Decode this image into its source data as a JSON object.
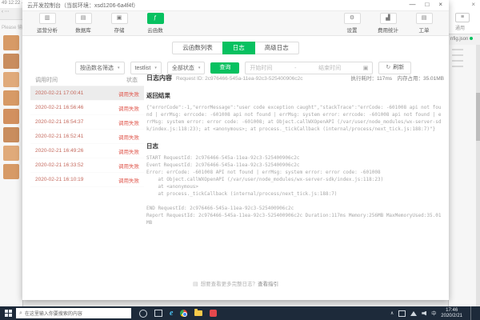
{
  "colors": {
    "accent": "#07c160",
    "error": "#e05a50",
    "date_text": "#c4685c"
  },
  "background_window": {
    "left_title": "49 12:22 -",
    "left_hint": "Please 输...",
    "right_close": "×",
    "right_menu_glyph": "≡",
    "right_label": "通用",
    "right_file_tab": "nfig.json"
  },
  "dialog": {
    "title": "云开发控制台（当前环境：xsd1206-6a4f4f）",
    "controls": {
      "minimize": "—",
      "maximize": "□",
      "close": "×"
    },
    "toolbar": {
      "nav": [
        {
          "label": "运营分析",
          "glyph": "▥"
        },
        {
          "label": "数据库",
          "glyph": "▤"
        },
        {
          "label": "存储",
          "glyph": "▣"
        },
        {
          "label": "云函数",
          "glyph": "ƒ"
        }
      ],
      "actions": [
        {
          "label": "设置",
          "glyph": "⚙"
        },
        {
          "label": "费用统计",
          "glyph": "▟"
        },
        {
          "label": "工单",
          "glyph": "▤"
        }
      ]
    },
    "tabs": [
      {
        "label": "云函数列表"
      },
      {
        "label": "日志"
      },
      {
        "label": "高级日志"
      }
    ],
    "filters": {
      "name_filter": "按函数名筛选",
      "function_name": "testlist",
      "status_filter": "全部状态",
      "query_label": "查询",
      "date_start_placeholder": "开始时间",
      "date_separator": "-",
      "date_end_placeholder": "结束时间",
      "calendar_glyph": "▣",
      "refresh_glyph": "↻",
      "refresh_label": "刷新",
      "caret": "▾"
    },
    "log_table": {
      "headers": [
        "调用时间",
        "状态"
      ],
      "rows": [
        {
          "time": "2020-02-21 17:00:41",
          "status": "调用失败"
        },
        {
          "time": "2020-02-21 16:56:46",
          "status": "调用失败"
        },
        {
          "time": "2020-02-21 16:54:37",
          "status": "调用失败"
        },
        {
          "time": "2020-02-21 16:52:41",
          "status": "调用失败"
        },
        {
          "time": "2020-02-21 16:49:26",
          "status": "调用失败"
        },
        {
          "time": "2020-02-21 16:33:52",
          "status": "调用失败"
        },
        {
          "time": "2020-02-21 16:10:19",
          "status": "调用失败"
        }
      ]
    },
    "detail": {
      "title": "日志内容",
      "request_id": "Request ID: 2c976466-545a-11ea-92c3-525400906c2c",
      "stats": "执行耗时：117ms　内存占用：35.01MB",
      "result_heading": "返回结果",
      "result_body": "{\"errorCode\":-1,\"errorMessage\":\"user code exception caught\",\"stackTrace\":\"errCode: -601008 api not found | errMsg: errcode: -601008 api not found | errMsg: system error: errcode: -601008 api not found | errMsg: system error: error code: -601008; at Object.callWXOpenAPI (/var/user/node_modules/wx-server-sdk/index.js:118:23); at <anonymous>; at process._tickCallback (internal/process/next_tick.js:188:7)\"}",
      "log_heading": "日志",
      "log_lines": [
        "START RequestId: 2c976466-545a-11ea-92c3-525400906c2c",
        "Event RequestId: 2c976466-545a-11ea-92c3-525400906c2c",
        "Error: errCode: -601008 API not found | errMsg: system error: error code: -601008",
        "    at Object.callWXOpenAPI (/var/user/node_modules/wx-server-sdk/index.js:118:23)",
        "    at <anonymous>",
        "    at process._tickCallback (internal/process/next_tick.js:188:7)",
        "",
        "END RequestId: 2c976466-545a-11ea-92c3-525400906c2c",
        "Report RequestId: 2c976466-545a-11ea-92c3-525400906c2c Duration:117ms Memory:256MB MaxMemoryUsed:35.01MB"
      ]
    },
    "footer": {
      "icon_glyph": "▤",
      "text": "想要查看更多完整日志？",
      "link": "查看指引"
    }
  },
  "taskbar": {
    "search_placeholder": "在这里输入你要搜索的内容",
    "lang": "中",
    "time": "17:46",
    "date": "2020/2/21"
  }
}
